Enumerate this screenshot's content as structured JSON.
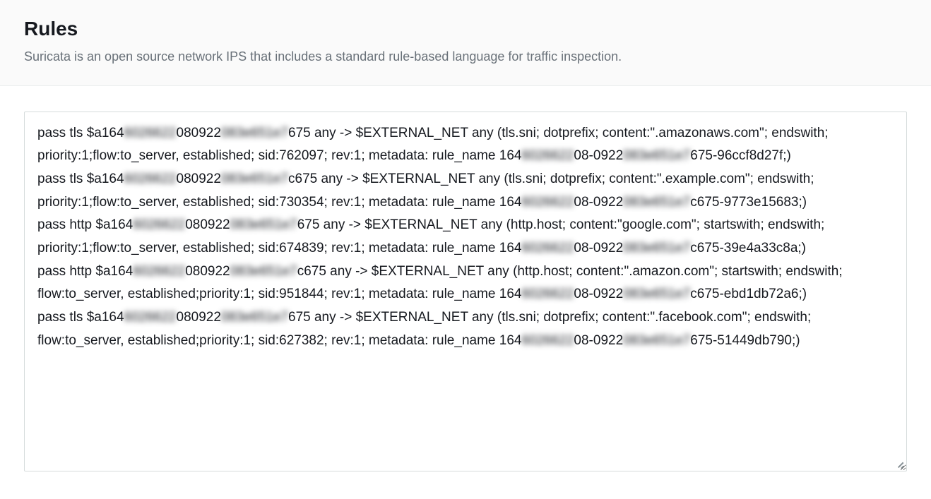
{
  "header": {
    "title": "Rules",
    "subtitle": "Suricata is an open source network IPS that includes a standard rule-based language for traffic inspection."
  },
  "rules": [
    {
      "p1": "pass tls $a164",
      "r1": "6026622",
      "p2": "080922",
      "r2": "083e651e7",
      "p3": "675 any -> $EXTERNAL_NET any (tls.sni; dotprefix; content:\".amazonaws.com\"; endswith; priority:1;flow:to_server, established; sid:762097; rev:1; metadata: rule_name 164",
      "r3": "6026622",
      "p4": "08-0922",
      "r4": "083e651e7",
      "p5": "675-96ccf8d27f;)"
    },
    {
      "p1": "pass tls $a164",
      "r1": "6026622",
      "p2": "080922",
      "r2": "083e651e7",
      "p3": "c675 any -> $EXTERNAL_NET any (tls.sni; dotprefix; content:\".example.com\"; endswith; priority:1;flow:to_server, established; sid:730354; rev:1; metadata: rule_name 164",
      "r3": "6026622",
      "p4": "08-0922",
      "r4": "083e651e7",
      "p5": "c675-9773e15683;)"
    },
    {
      "p1": "pass http $a164",
      "r1": "6026622",
      "p2": "080922",
      "r2": "083e651e7",
      "p3": "675 any -> $EXTERNAL_NET any (http.host; content:\"google.com\"; startswith; endswith; priority:1;flow:to_server, established; sid:674839; rev:1; metadata: rule_name 164",
      "r3": "6026622",
      "p4": "08-0922",
      "r4": "083e651e7",
      "p5": "c675-39e4a33c8a;)"
    },
    {
      "p1": "pass http $a164",
      "r1": "6026622",
      "p2": "080922",
      "r2": "083e651e7",
      "p3": "c675 any -> $EXTERNAL_NET any (http.host; content:\".amazon.com\"; startswith; endswith; flow:to_server, established;priority:1; sid:951844; rev:1; metadata: rule_name 164",
      "r3": "6026622",
      "p4": "08-0922",
      "r4": "083e651e7",
      "p5": "c675-ebd1db72a6;)"
    },
    {
      "p1": "pass tls $a164",
      "r1": "6026622",
      "p2": "080922",
      "r2": "083e651e7",
      "p3": "675 any -> $EXTERNAL_NET any (tls.sni; dotprefix; content:\".facebook.com\"; endswith; flow:to_server, established;priority:1; sid:627382; rev:1; metadata: rule_name 164",
      "r3": "6026622",
      "p4": "08-0922",
      "r4": "083e651e7",
      "p5": "675-51449db790;)"
    }
  ]
}
